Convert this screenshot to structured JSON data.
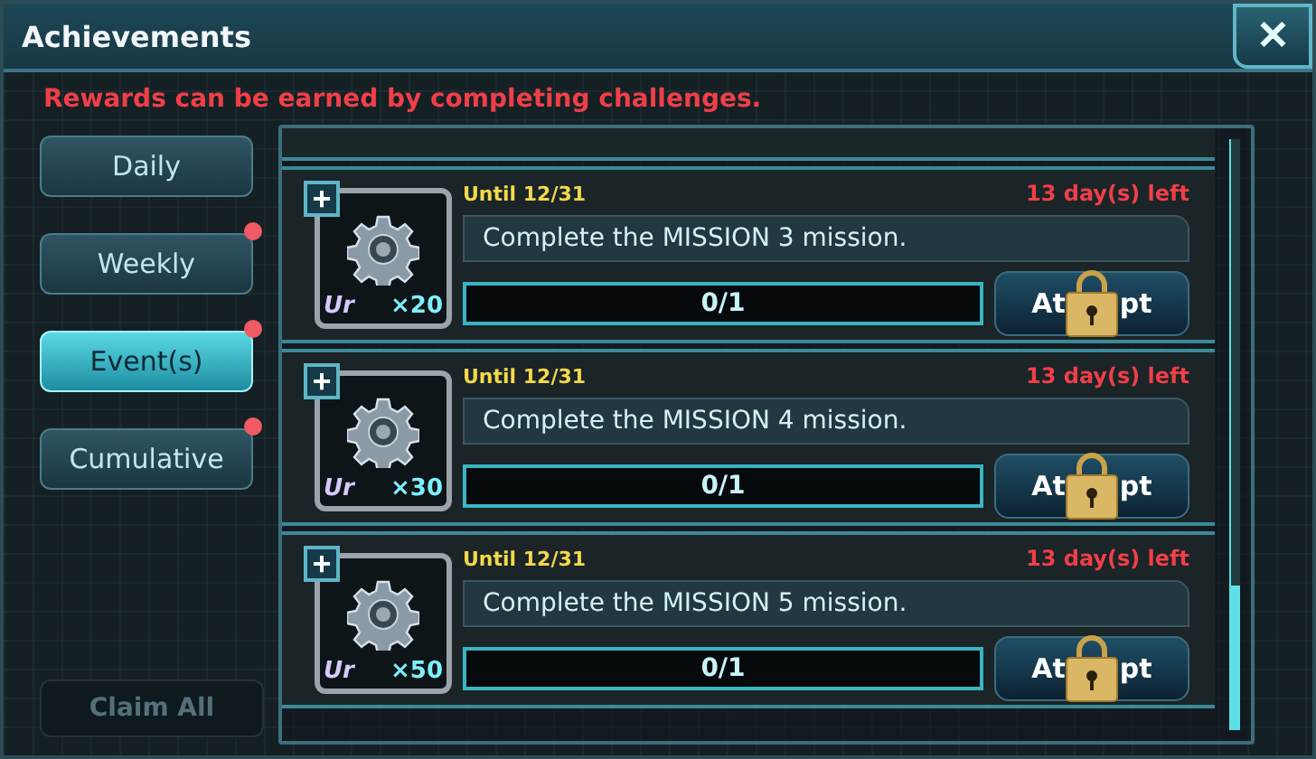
{
  "window": {
    "title": "Achievements",
    "close": "✕"
  },
  "notice": "Rewards can be earned by completing challenges.",
  "tabs": [
    {
      "label": "Daily",
      "selected": false,
      "badge": false
    },
    {
      "label": "Weekly",
      "selected": false,
      "badge": true
    },
    {
      "label": "Event(s)",
      "selected": true,
      "badge": true
    },
    {
      "label": "Cumulative",
      "selected": false,
      "badge": true
    }
  ],
  "claim_all": {
    "label": "Claim All",
    "disabled": true
  },
  "missions": [
    {
      "until": "Until 12/31",
      "left": "13 day(s) left",
      "text": "Complete the MISSION 3 mission.",
      "add": "+",
      "rarity": "Ur",
      "count": "×20",
      "progress": "0/1",
      "button_start": "At",
      "button_end": "pt",
      "locked": true
    },
    {
      "until": "Until 12/31",
      "left": "13 day(s) left",
      "text": "Complete the MISSION 4 mission.",
      "add": "+",
      "rarity": "Ur",
      "count": "×30",
      "progress": "0/1",
      "button_start": "At",
      "button_end": "pt",
      "locked": true
    },
    {
      "until": "Until 12/31",
      "left": "13 day(s) left",
      "text": "Complete the MISSION 5 mission.",
      "add": "+",
      "rarity": "Ur",
      "count": "×50",
      "progress": "0/1",
      "button_start": "At",
      "button_end": "pt",
      "locked": true
    }
  ]
}
